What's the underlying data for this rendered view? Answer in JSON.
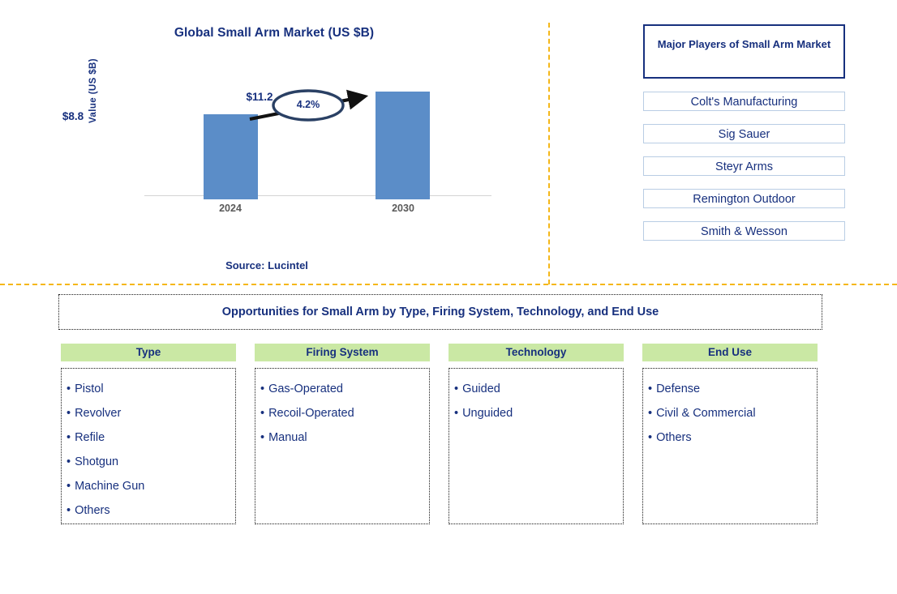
{
  "chart_data": {
    "type": "bar",
    "title": "Global Small Arm Market (US $B)",
    "ylabel": "Value (US $B)",
    "xlabel": "",
    "categories": [
      "2024",
      "2030"
    ],
    "values": [
      8.8,
      11.2
    ],
    "value_labels": [
      "$8.8",
      "$11.2"
    ],
    "cagr_label": "4.2%",
    "ylim": [
      0,
      12.6
    ],
    "grid": false,
    "legend": "none",
    "bar_color": "#5b8dc8",
    "annotation": "4.2% CAGR arrow from 2024 bar to 2030 bar",
    "source": "Source: Lucintel"
  },
  "chart": {
    "title": "Global Small Arm Market (US $B)",
    "y_axis_title": "Value (US $B)",
    "bars": [
      {
        "category": "2024",
        "value_label": "$8.8"
      },
      {
        "category": "2030",
        "value_label": "$11.2"
      }
    ],
    "cagr": "4.2%",
    "source": "Source: Lucintel"
  },
  "players": {
    "header": "Major Players of Small Arm Market",
    "items": [
      "Colt's Manufacturing",
      "Sig Sauer",
      "Steyr Arms",
      "Remington Outdoor",
      "Smith & Wesson"
    ]
  },
  "opportunities": {
    "banner": "Opportunities for Small Arm by Type, Firing System, Technology, and End Use",
    "columns": [
      {
        "header": "Type",
        "items": [
          "Pistol",
          "Revolver",
          "Refile",
          "Shotgun",
          "Machine Gun",
          "Others"
        ]
      },
      {
        "header": "Firing System",
        "items": [
          "Gas-Operated",
          "Recoil-Operated",
          "Manual"
        ]
      },
      {
        "header": "Technology",
        "items": [
          "Guided",
          "Unguided"
        ]
      },
      {
        "header": "End Use",
        "items": [
          "Defense",
          "Civil & Commercial",
          "Others"
        ]
      }
    ],
    "bullet_glyph": "•"
  },
  "colors": {
    "navy": "#17307e",
    "bar_blue": "#5b8dc8",
    "divider_orange": "#f5b719",
    "header_green": "#cae8a4",
    "player_border": "#b9cde4"
  }
}
